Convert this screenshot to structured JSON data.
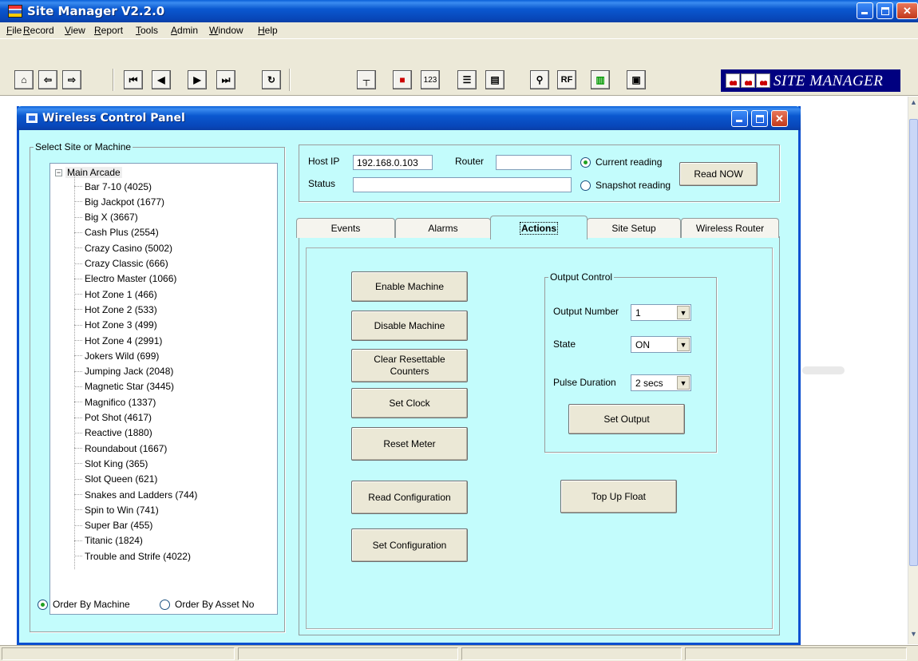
{
  "app": {
    "title": "Site Manager  V2.2.0",
    "brand": "SITE MANAGER"
  },
  "menu": [
    "File",
    "Record",
    "View",
    "Report",
    "Tools",
    "Admin",
    "Window",
    "Help"
  ],
  "toolbar": {
    "btn_123": "123",
    "btn_rf": "RF"
  },
  "panel": {
    "title": "Wireless Control Panel",
    "site_group_label": "Select Site or Machine",
    "tree_root": "Main Arcade",
    "machines": [
      "Bar 7-10 (4025)",
      "Big Jackpot (1677)",
      "Big X (3667)",
      "Cash Plus (2554)",
      "Crazy Casino (5002)",
      "Crazy Classic (666)",
      "Electro Master (1066)",
      "Hot Zone 1 (466)",
      "Hot Zone 2 (533)",
      "Hot Zone 3 (499)",
      "Hot Zone 4 (2991)",
      "Jokers Wild (699)",
      "Jumping Jack (2048)",
      "Magnetic Star (3445)",
      "Magnifico (1337)",
      "Pot Shot (4617)",
      "Reactive (1880)",
      "Roundabout (1667)",
      "Slot King (365)",
      "Slot Queen (621)",
      "Snakes and Ladders (744)",
      "Spin to Win (741)",
      "Super Bar (455)",
      "Titanic (1824)",
      "Trouble and Strife (4022)"
    ],
    "order_by_machine": "Order By Machine",
    "order_by_asset": "Order By Asset No"
  },
  "connection": {
    "host_ip_label": "Host IP",
    "host_ip": "192.168.0.103",
    "router_label": "Router",
    "router_value": "",
    "status_label": "Status",
    "status_value": "",
    "current_reading": "Current reading",
    "snapshot_reading": "Snapshot reading",
    "read_now": "Read NOW"
  },
  "tabs": [
    "Events",
    "Alarms",
    "Actions",
    "Site Setup",
    "Wireless Router"
  ],
  "active_tab": "Actions",
  "actions": {
    "enable_machine": "Enable Machine",
    "disable_machine": "Disable Machine",
    "clear_counters": "Clear Resettable Counters",
    "set_clock": "Set Clock",
    "reset_meter": "Reset Meter",
    "read_configuration": "Read Configuration",
    "set_configuration": "Set Configuration",
    "top_up_float": "Top Up Float"
  },
  "output_control": {
    "group_label": "Output Control",
    "output_number_label": "Output Number",
    "output_number": "1",
    "state_label": "State",
    "state": "ON",
    "pulse_label": "Pulse Duration",
    "pulse": "2 secs",
    "set_output": "Set Output"
  }
}
